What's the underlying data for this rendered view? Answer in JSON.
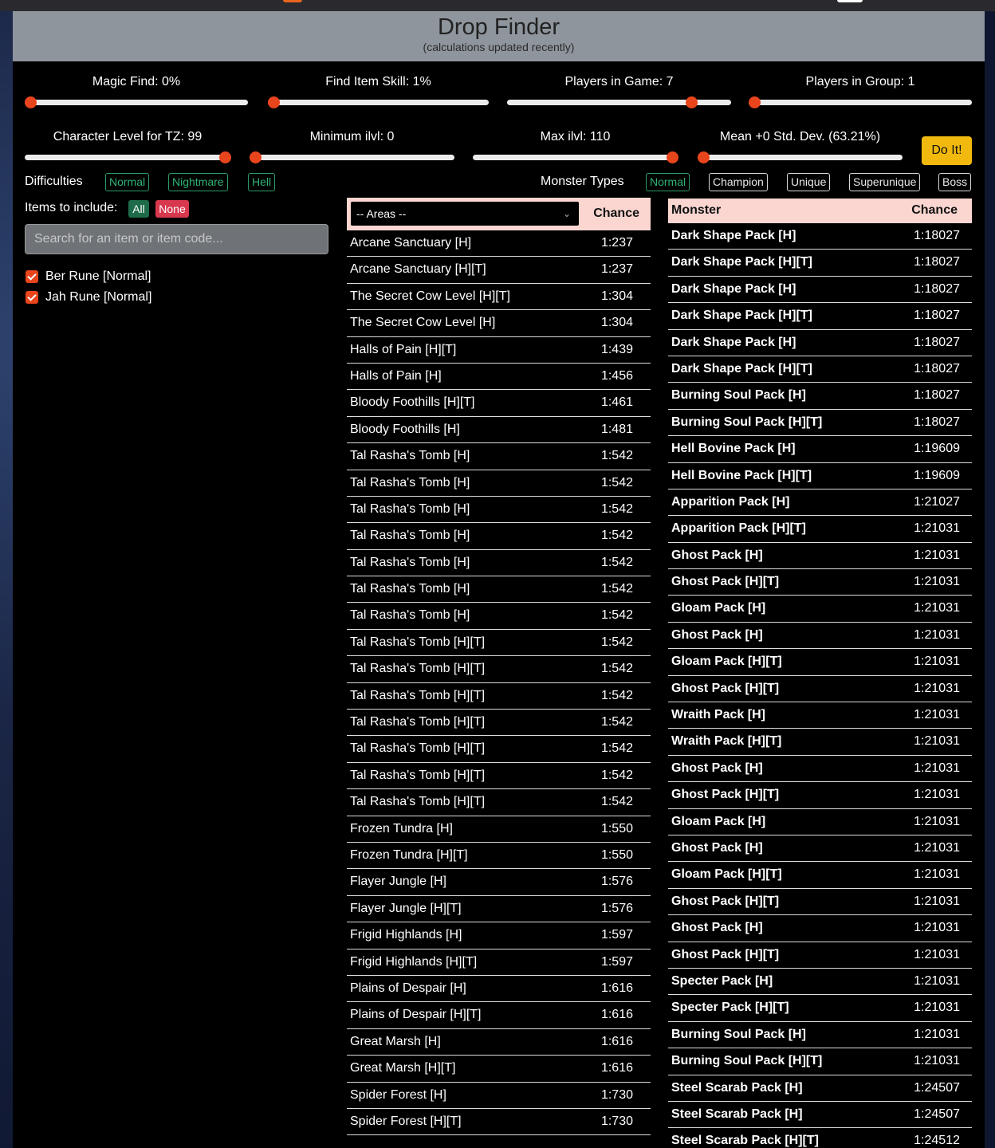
{
  "header": {
    "title": "Drop Finder",
    "subtitle": "(calculations updated recently)"
  },
  "sliders": [
    {
      "label": "Magic Find: 0%",
      "level": 0.0
    },
    {
      "label": "Find Item Skill: 1%",
      "level": 0.0
    },
    {
      "label": "Players in Game: 7",
      "level": 0.84
    },
    {
      "label": "Players in Group: 1",
      "level": 0.0
    },
    {
      "label": "Character Level for TZ: 99",
      "level": 1.0
    },
    {
      "label": "Minimum ilvl: 0",
      "level": 0.0
    },
    {
      "label": "Max ilvl: 110",
      "level": 1.0
    },
    {
      "label": "Mean +0 Std. Dev. (63.21%)",
      "level": 0.0
    }
  ],
  "do_it_label": "Do It!",
  "difficulties": {
    "label": "Difficulties",
    "options": [
      "Normal",
      "Nightmare",
      "Hell"
    ]
  },
  "monster_types": {
    "label": "Monster Types",
    "options": [
      "Normal",
      "Champion",
      "Unique",
      "Superunique",
      "Boss"
    ]
  },
  "items": {
    "label": "Items to include:",
    "all_label": "All",
    "none_label": "None",
    "search_placeholder": "Search for an item or item code...",
    "selected": [
      "Ber Rune [Normal]",
      "Jah Rune [Normal]"
    ]
  },
  "areas": {
    "select_label": "-- Areas --",
    "chance_header": "Chance",
    "rows": [
      [
        "Arcane Sanctuary [H]",
        "1:237"
      ],
      [
        "Arcane Sanctuary [H][T]",
        "1:237"
      ],
      [
        "The Secret Cow Level [H][T]",
        "1:304"
      ],
      [
        "The Secret Cow Level [H]",
        "1:304"
      ],
      [
        "Halls of Pain [H][T]",
        "1:439"
      ],
      [
        "Halls of Pain [H]",
        "1:456"
      ],
      [
        "Bloody Foothills [H][T]",
        "1:461"
      ],
      [
        "Bloody Foothills [H]",
        "1:481"
      ],
      [
        "Tal Rasha's Tomb [H]",
        "1:542"
      ],
      [
        "Tal Rasha's Tomb [H]",
        "1:542"
      ],
      [
        "Tal Rasha's Tomb [H]",
        "1:542"
      ],
      [
        "Tal Rasha's Tomb [H]",
        "1:542"
      ],
      [
        "Tal Rasha's Tomb [H]",
        "1:542"
      ],
      [
        "Tal Rasha's Tomb [H]",
        "1:542"
      ],
      [
        "Tal Rasha's Tomb [H]",
        "1:542"
      ],
      [
        "Tal Rasha's Tomb [H][T]",
        "1:542"
      ],
      [
        "Tal Rasha's Tomb [H][T]",
        "1:542"
      ],
      [
        "Tal Rasha's Tomb [H][T]",
        "1:542"
      ],
      [
        "Tal Rasha's Tomb [H][T]",
        "1:542"
      ],
      [
        "Tal Rasha's Tomb [H][T]",
        "1:542"
      ],
      [
        "Tal Rasha's Tomb [H][T]",
        "1:542"
      ],
      [
        "Tal Rasha's Tomb [H][T]",
        "1:542"
      ],
      [
        "Frozen Tundra [H]",
        "1:550"
      ],
      [
        "Frozen Tundra [H][T]",
        "1:550"
      ],
      [
        "Flayer Jungle [H]",
        "1:576"
      ],
      [
        "Flayer Jungle [H][T]",
        "1:576"
      ],
      [
        "Frigid Highlands [H]",
        "1:597"
      ],
      [
        "Frigid Highlands [H][T]",
        "1:597"
      ],
      [
        "Plains of Despair [H]",
        "1:616"
      ],
      [
        "Plains of Despair [H][T]",
        "1:616"
      ],
      [
        "Great Marsh [H]",
        "1:616"
      ],
      [
        "Great Marsh [H][T]",
        "1:616"
      ],
      [
        "Spider Forest [H]",
        "1:730"
      ],
      [
        "Spider Forest [H][T]",
        "1:730"
      ]
    ]
  },
  "monsters": {
    "name_header": "Monster",
    "chance_header": "Chance",
    "rows": [
      [
        "Dark Shape Pack [H]",
        "1:18027"
      ],
      [
        "Dark Shape Pack [H][T]",
        "1:18027"
      ],
      [
        "Dark Shape Pack [H]",
        "1:18027"
      ],
      [
        "Dark Shape Pack [H][T]",
        "1:18027"
      ],
      [
        "Dark Shape Pack [H]",
        "1:18027"
      ],
      [
        "Dark Shape Pack [H][T]",
        "1:18027"
      ],
      [
        "Burning Soul Pack [H]",
        "1:18027"
      ],
      [
        "Burning Soul Pack [H][T]",
        "1:18027"
      ],
      [
        "Hell Bovine Pack [H]",
        "1:19609"
      ],
      [
        "Hell Bovine Pack [H][T]",
        "1:19609"
      ],
      [
        "Apparition Pack [H]",
        "1:21027"
      ],
      [
        "Apparition Pack [H][T]",
        "1:21031"
      ],
      [
        "Ghost Pack [H]",
        "1:21031"
      ],
      [
        "Ghost Pack [H][T]",
        "1:21031"
      ],
      [
        "Gloam Pack [H]",
        "1:21031"
      ],
      [
        "Ghost Pack [H]",
        "1:21031"
      ],
      [
        "Gloam Pack [H][T]",
        "1:21031"
      ],
      [
        "Ghost Pack [H][T]",
        "1:21031"
      ],
      [
        "Wraith Pack [H]",
        "1:21031"
      ],
      [
        "Wraith Pack [H][T]",
        "1:21031"
      ],
      [
        "Ghost Pack [H]",
        "1:21031"
      ],
      [
        "Ghost Pack [H][T]",
        "1:21031"
      ],
      [
        "Gloam Pack [H]",
        "1:21031"
      ],
      [
        "Ghost Pack [H]",
        "1:21031"
      ],
      [
        "Gloam Pack [H][T]",
        "1:21031"
      ],
      [
        "Ghost Pack [H][T]",
        "1:21031"
      ],
      [
        "Ghost Pack [H]",
        "1:21031"
      ],
      [
        "Ghost Pack [H][T]",
        "1:21031"
      ],
      [
        "Specter Pack [H]",
        "1:21031"
      ],
      [
        "Specter Pack [H][T]",
        "1:21031"
      ],
      [
        "Burning Soul Pack [H]",
        "1:21031"
      ],
      [
        "Burning Soul Pack [H][T]",
        "1:21031"
      ],
      [
        "Steel Scarab Pack [H]",
        "1:24507"
      ],
      [
        "Steel Scarab Pack [H]",
        "1:24507"
      ],
      [
        "Steel Scarab Pack [H][T]",
        "1:24512"
      ]
    ]
  }
}
